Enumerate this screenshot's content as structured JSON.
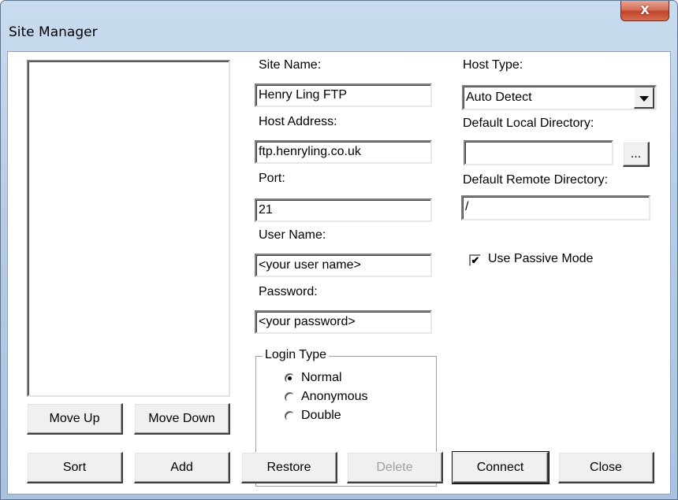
{
  "window": {
    "title": "Site Manager",
    "close_glyph": "X"
  },
  "site_list": {
    "items": []
  },
  "labels": {
    "site_name": "Site Name:",
    "host_address": "Host Address:",
    "port": "Port:",
    "user_name": "User Name:",
    "password": "Password:",
    "host_type": "Host Type:",
    "default_local_dir": "Default Local Directory:",
    "default_remote_dir": "Default Remote Directory:"
  },
  "fields": {
    "site_name": "Henry Ling FTP",
    "host_address": "ftp.henryling.co.uk",
    "port": "21",
    "user_name": "<your user name>",
    "password": "<your password>",
    "host_type": "Auto Detect",
    "default_local_dir": "",
    "default_remote_dir": "/"
  },
  "browse_button": "...",
  "passive_mode": {
    "label": "Use Passive Mode",
    "checked": true,
    "check_glyph": "✔"
  },
  "login_type": {
    "legend": "Login Type",
    "options": [
      "Normal",
      "Anonymous",
      "Double"
    ],
    "selected": "Normal"
  },
  "buttons": {
    "move_up": "Move Up",
    "move_down": "Move Down",
    "sort": "Sort",
    "add": "Add",
    "restore": "Restore",
    "delete": "Delete",
    "connect": "Connect",
    "close": "Close"
  },
  "colors": {
    "titlebar": "#b7cde6",
    "close_button": "#c0432a",
    "disabled_text": "#a0a0a0"
  }
}
